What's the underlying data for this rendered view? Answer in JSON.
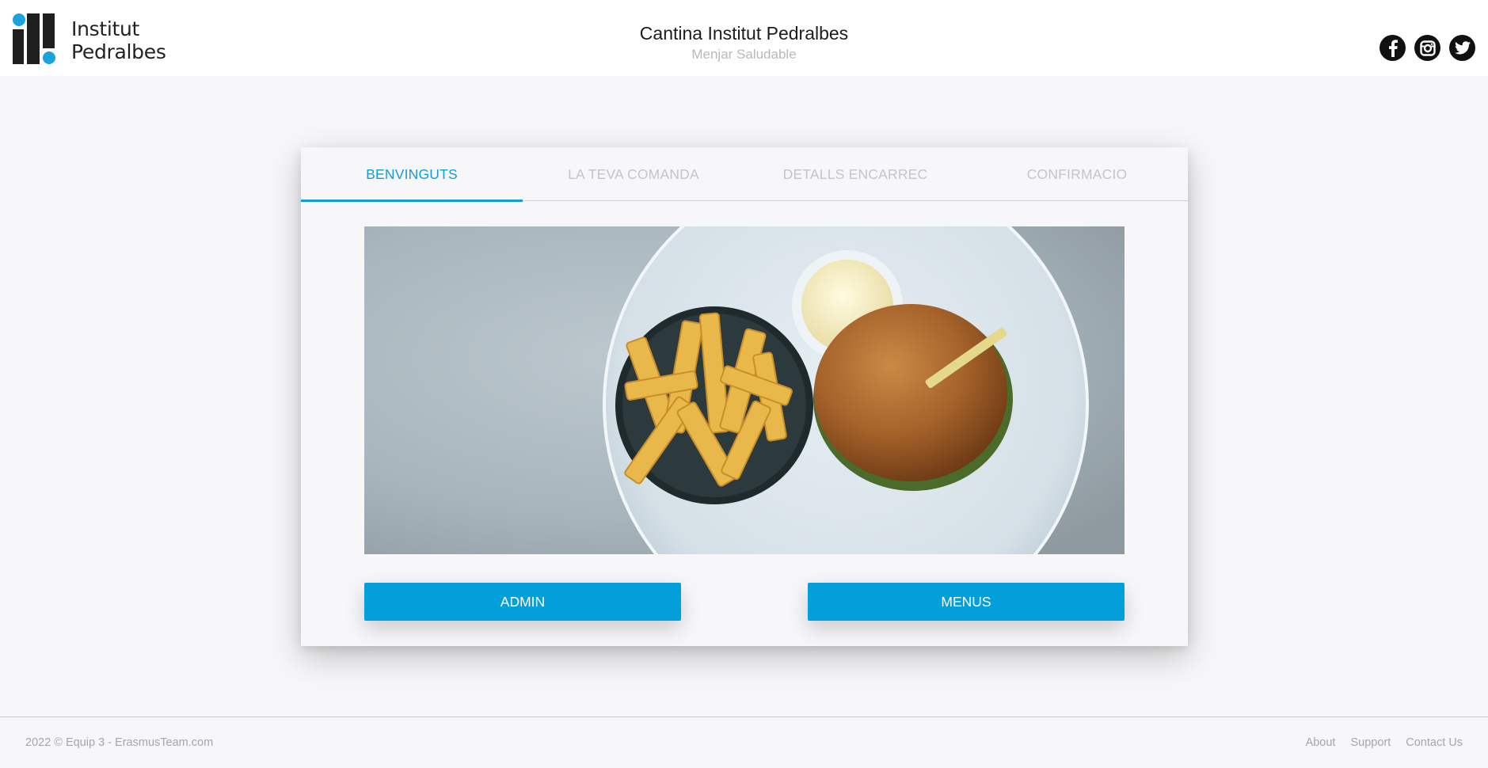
{
  "header": {
    "logo_line1": "Institut",
    "logo_line2": "Pedralbes",
    "title": "Cantina Institut Pedralbes",
    "subtitle": "Menjar Saludable",
    "socials": [
      {
        "icon": "facebook-icon"
      },
      {
        "icon": "instagram-icon"
      },
      {
        "icon": "twitter-icon"
      }
    ]
  },
  "tabs": [
    {
      "label": "BENVINGUTS",
      "active": true
    },
    {
      "label": "LA TEVA COMANDA",
      "active": false
    },
    {
      "label": "DETALLS ENCARREC",
      "active": false
    },
    {
      "label": "CONFIRMACIO",
      "active": false
    }
  ],
  "buttons": {
    "admin": "ADMIN",
    "menus": "MENUS"
  },
  "footer": {
    "copyright": "2022 © Equip 3 - ErasmusTeam.com",
    "links": [
      "About",
      "Support",
      "Contact Us"
    ]
  },
  "colors": {
    "accent": "#039fdb",
    "logo_blue": "#1aa3dc",
    "background": "#f7f7f9"
  }
}
